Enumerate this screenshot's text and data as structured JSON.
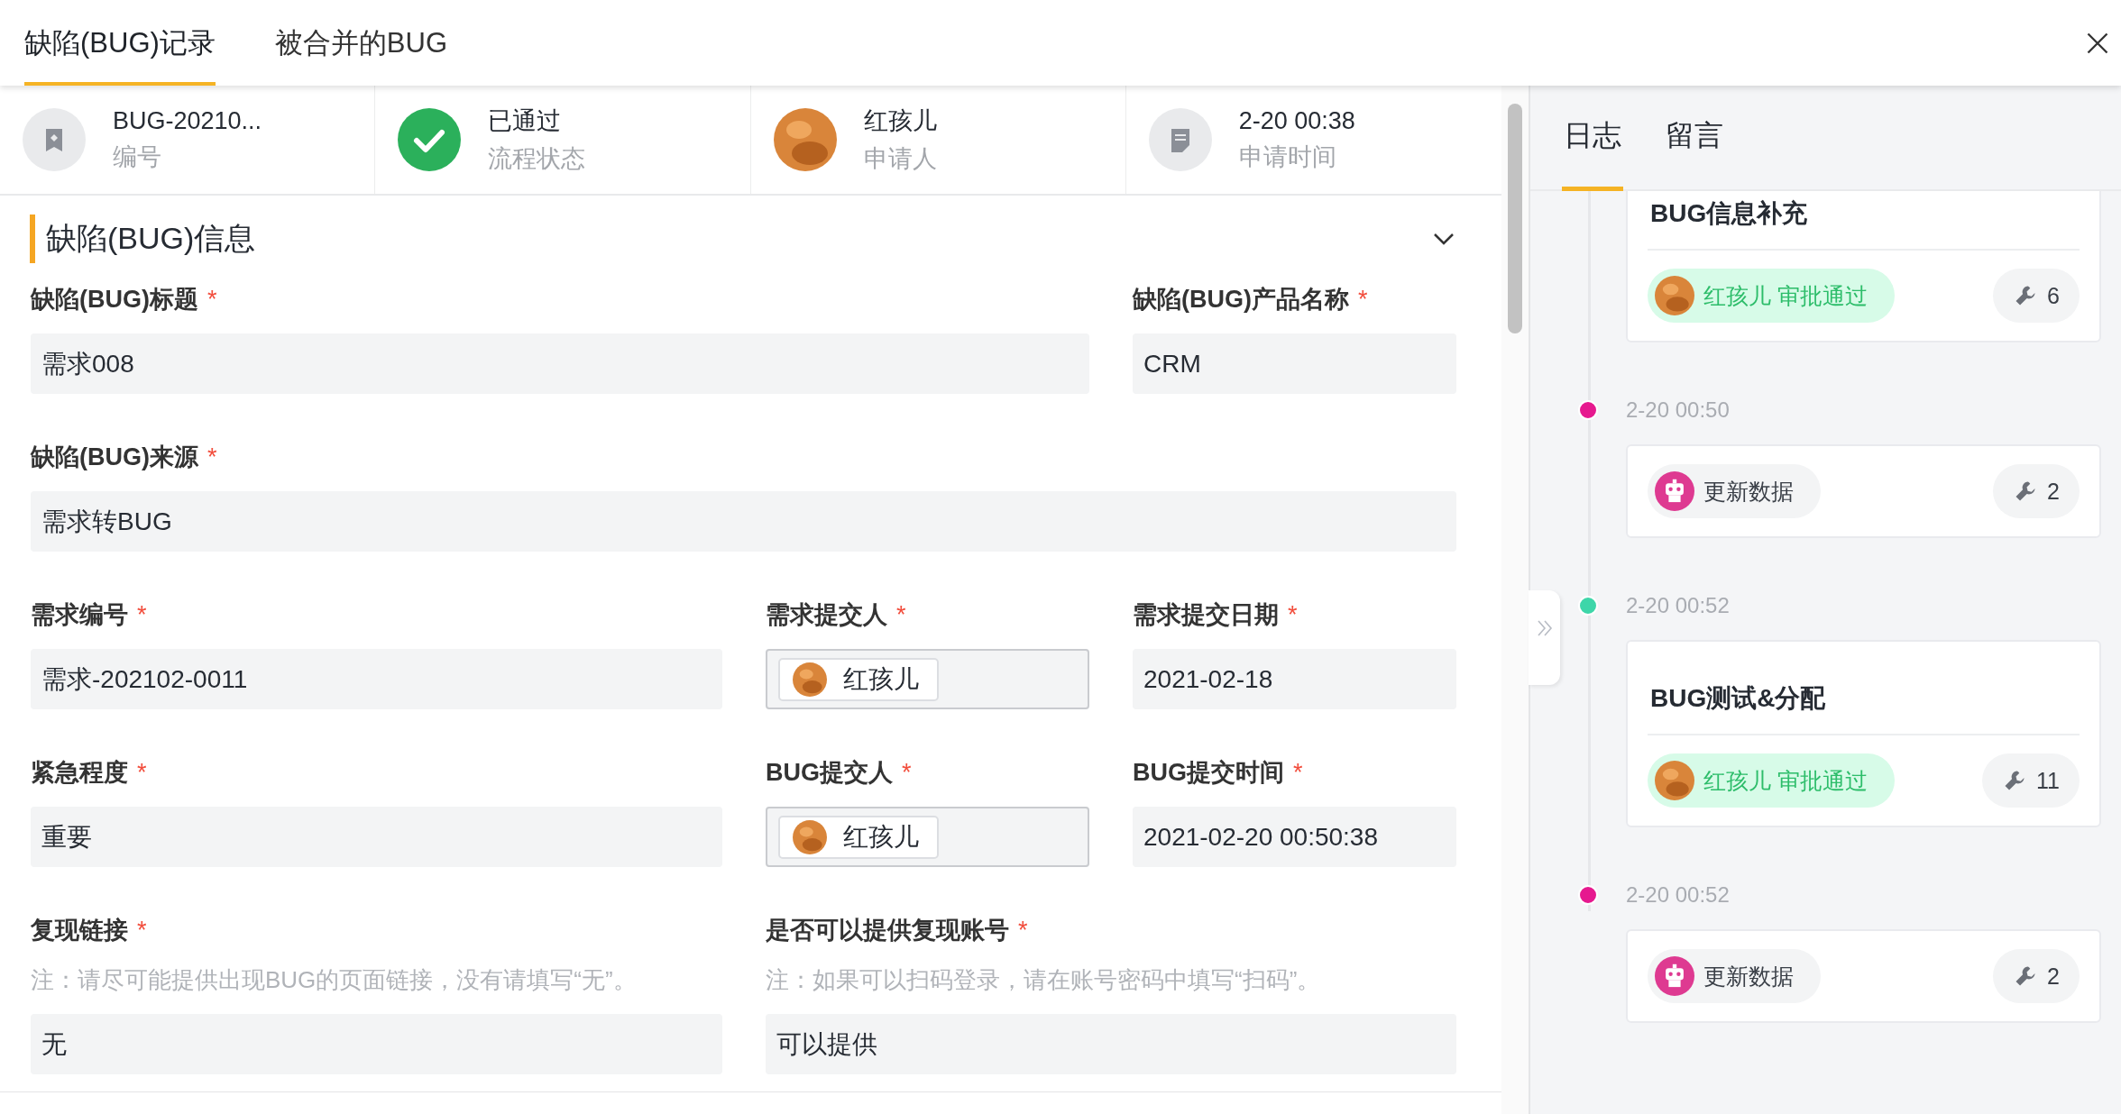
{
  "tabs": [
    {
      "label": "缺陷(BUG)记录",
      "selected": true
    },
    {
      "label": "被合并的BUG",
      "selected": false
    }
  ],
  "summary": [
    {
      "kind": "bookmark",
      "value": "BUG-20210...",
      "label": "编号"
    },
    {
      "kind": "check",
      "value": "已通过",
      "label": "流程状态"
    },
    {
      "kind": "avatar",
      "value": "红孩儿",
      "label": "申请人"
    },
    {
      "kind": "document",
      "value": "2-20 00:38",
      "label": "申请时间"
    }
  ],
  "section": {
    "title": "缺陷(BUG)信息",
    "expanded": true
  },
  "rows": [
    [
      {
        "label": "缺陷(BUG)标题",
        "mark": "*",
        "kind": "text",
        "value": "需求008"
      },
      {
        "label": "缺陷(BUG)产品名称",
        "mark": "*",
        "kind": "text",
        "value": "CRM"
      }
    ],
    [
      {
        "label": "缺陷(BUG)来源",
        "mark": "*",
        "kind": "text",
        "value": "需求转BUG"
      }
    ],
    [
      {
        "label": "需求编号",
        "mark": "*",
        "kind": "text",
        "value": "需求-202102-0011"
      },
      {
        "label": "需求提交人",
        "mark": "*",
        "kind": "person",
        "value": "红孩儿"
      },
      {
        "label": "需求提交日期",
        "mark": "*",
        "kind": "text",
        "value": "2021-02-18"
      }
    ],
    [
      {
        "label": "紧急程度",
        "mark": "*",
        "kind": "text",
        "value": "重要"
      },
      {
        "label": "BUG提交人",
        "mark": "*",
        "kind": "person",
        "value": "红孩儿"
      },
      {
        "label": "BUG提交时间",
        "mark": "*",
        "kind": "text",
        "value": "2021-02-20 00:50:38"
      }
    ],
    [
      {
        "label": "复现链接",
        "mark": "*",
        "kind": "text",
        "note": "注：请尽可能提供出现BUG的页面链接，没有请填写“无”。",
        "value": "无"
      },
      {
        "label": "是否可以提供复现账号",
        "mark": "*",
        "kind": "text",
        "note": "注：如果可以扫码登录，请在账号密码中填写“扫码”。",
        "value": "可以提供"
      }
    ]
  ],
  "log_tabs": [
    {
      "label": "日志",
      "selected": true
    },
    {
      "label": "留言",
      "selected": false
    }
  ],
  "log": [
    {
      "kind": "approval",
      "title": "BUG信息补充",
      "actor": "红孩儿",
      "action": "审批通过",
      "count": "6"
    },
    {
      "kind": "update",
      "time": "2-20 00:50",
      "color": "#e6198f",
      "action": "更新数据",
      "count": "2"
    },
    {
      "kind": "approval",
      "time": "2-20 00:52",
      "color": "#3ed6a9",
      "title": "BUG测试&分配",
      "actor": "红孩儿",
      "action": "审批通过",
      "count": "11"
    },
    {
      "kind": "update",
      "time": "2-20 00:52",
      "color": "#e6198f",
      "action": "更新数据",
      "count": "2"
    }
  ]
}
